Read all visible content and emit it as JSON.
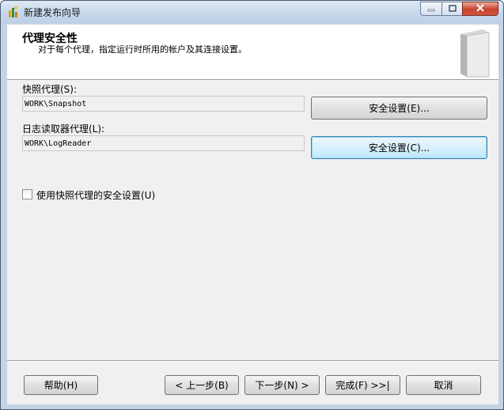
{
  "window": {
    "title": "新建发布向导"
  },
  "header": {
    "title": "代理安全性",
    "subtitle": "对于每个代理，指定运行时所用的帐户及其连接设置。"
  },
  "snapshot": {
    "label": "快照代理(S):",
    "value": "WORK\\Snapshot",
    "button": "安全设置(E)..."
  },
  "logreader": {
    "label": "日志读取器代理(L):",
    "value": "WORK\\LogReader",
    "button": "安全设置(C)..."
  },
  "checkbox": {
    "label": "使用快照代理的安全设置(U)",
    "checked": false
  },
  "footer": {
    "help": "帮助(H)",
    "back": "< 上一步(B)",
    "next": "下一步(N) >",
    "finish": "完成(F) >>|",
    "cancel": "取消"
  },
  "colors": {
    "titlebar": "#c9d9ec",
    "close": "#c7432e",
    "focus_border": "#3c7fb1"
  },
  "icons": [
    "wizard-app-icon",
    "minimize-icon",
    "maximize-icon",
    "close-icon",
    "wizard-book-icon"
  ]
}
